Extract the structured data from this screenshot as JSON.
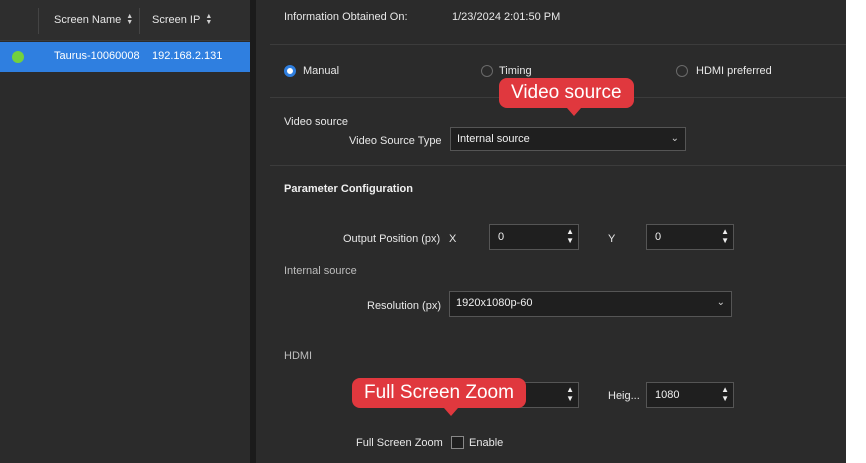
{
  "screen_list": {
    "columns": [
      "Screen Name",
      "Screen IP"
    ],
    "rows": [
      {
        "name": "Taurus-10060008",
        "ip": "192.168.2.131",
        "status_color": "#73d13d"
      }
    ]
  },
  "info": {
    "label": "Information Obtained On:",
    "value": "1/23/2024 2:01:50 PM"
  },
  "mode": {
    "options": [
      "Manual",
      "Timing",
      "HDMI preferred"
    ],
    "selected": "Manual"
  },
  "video_source": {
    "section_label": "Video source",
    "type_label": "Video Source Type",
    "type_value": "Internal source"
  },
  "parameters": {
    "title": "Parameter Configuration",
    "output_position_label": "Output Position (px)",
    "x_label": "X",
    "x_value": "0",
    "y_label": "Y",
    "y_value": "0"
  },
  "internal_source": {
    "section_label": "Internal source",
    "resolution_label": "Resolution (px)",
    "resolution_value": "1920x1080p-60"
  },
  "hdmi": {
    "section_label": "HDMI",
    "height_label": "Heig...",
    "height_value": "1080",
    "full_screen_zoom_label": "Full Screen Zoom",
    "enable_label": "Enable",
    "enabled": false
  },
  "callouts": {
    "video_source": "Video source",
    "full_screen_zoom": "Full Screen Zoom"
  },
  "colors": {
    "accent": "#2f7fe0",
    "callout": "#e0383e",
    "panel": "#2b2b2b"
  }
}
